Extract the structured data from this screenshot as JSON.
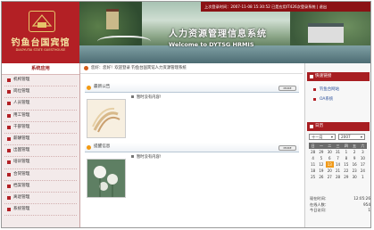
{
  "brand": {
    "name_cn": "钓鱼台国宾馆",
    "name_en": "DIAOYUTAI STATE GUESTHOUSE"
  },
  "banner": {
    "title_cn": "人力资源管理信息系统",
    "title_en": "Welcome to DYTSG HRMIS"
  },
  "status_text": "上次登录时间：2007-11-08 15:30:52 已是应用IT426次登录系统 | 退出",
  "sidebar": {
    "title": "系统应用",
    "items": [
      "机构管理",
      "岗位管理",
      "人员管理",
      "用工管理",
      "干部管理",
      "薪酬管理",
      "出国管理",
      "培训管理",
      "合同管理",
      "档案管理",
      "离退管理",
      "系统管理"
    ]
  },
  "welcome": "您好：您好！欢迎登录 钓鱼台国宾馆人力资源管理系统",
  "panels": [
    {
      "title": "最新公告",
      "more": "MORE",
      "message": "暂时没有内容!"
    },
    {
      "title": "提醒信息",
      "more": "MORE",
      "message": "暂时没有内容!"
    }
  ],
  "shortcuts": {
    "title": "快速链接",
    "links": [
      "钓鱼台网站",
      "OA系统"
    ]
  },
  "calendar": {
    "title": "日历",
    "month": "十一月",
    "year": "2007",
    "weekdays": [
      "日",
      "一",
      "二",
      "三",
      "四",
      "五",
      "六"
    ],
    "days": [
      "28",
      "29",
      "30",
      "31",
      "1",
      "2",
      "3",
      "4",
      "5",
      "6",
      "7",
      "8",
      "9",
      "10",
      "11",
      "12",
      "13",
      "14",
      "15",
      "16",
      "17",
      "18",
      "19",
      "20",
      "21",
      "22",
      "23",
      "24",
      "25",
      "26",
      "27",
      "28",
      "29",
      "30",
      "1"
    ],
    "today": "13"
  },
  "stats": [
    {
      "label": "现在时间：",
      "value": "12:05:26"
    },
    {
      "label": "在线人数：",
      "value": "954"
    },
    {
      "label": "今日访问：",
      "value": "1"
    }
  ],
  "colors": {
    "brand_red": "#b32025",
    "dark_red": "#8b1114",
    "accent_orange": "#f09a1a"
  }
}
